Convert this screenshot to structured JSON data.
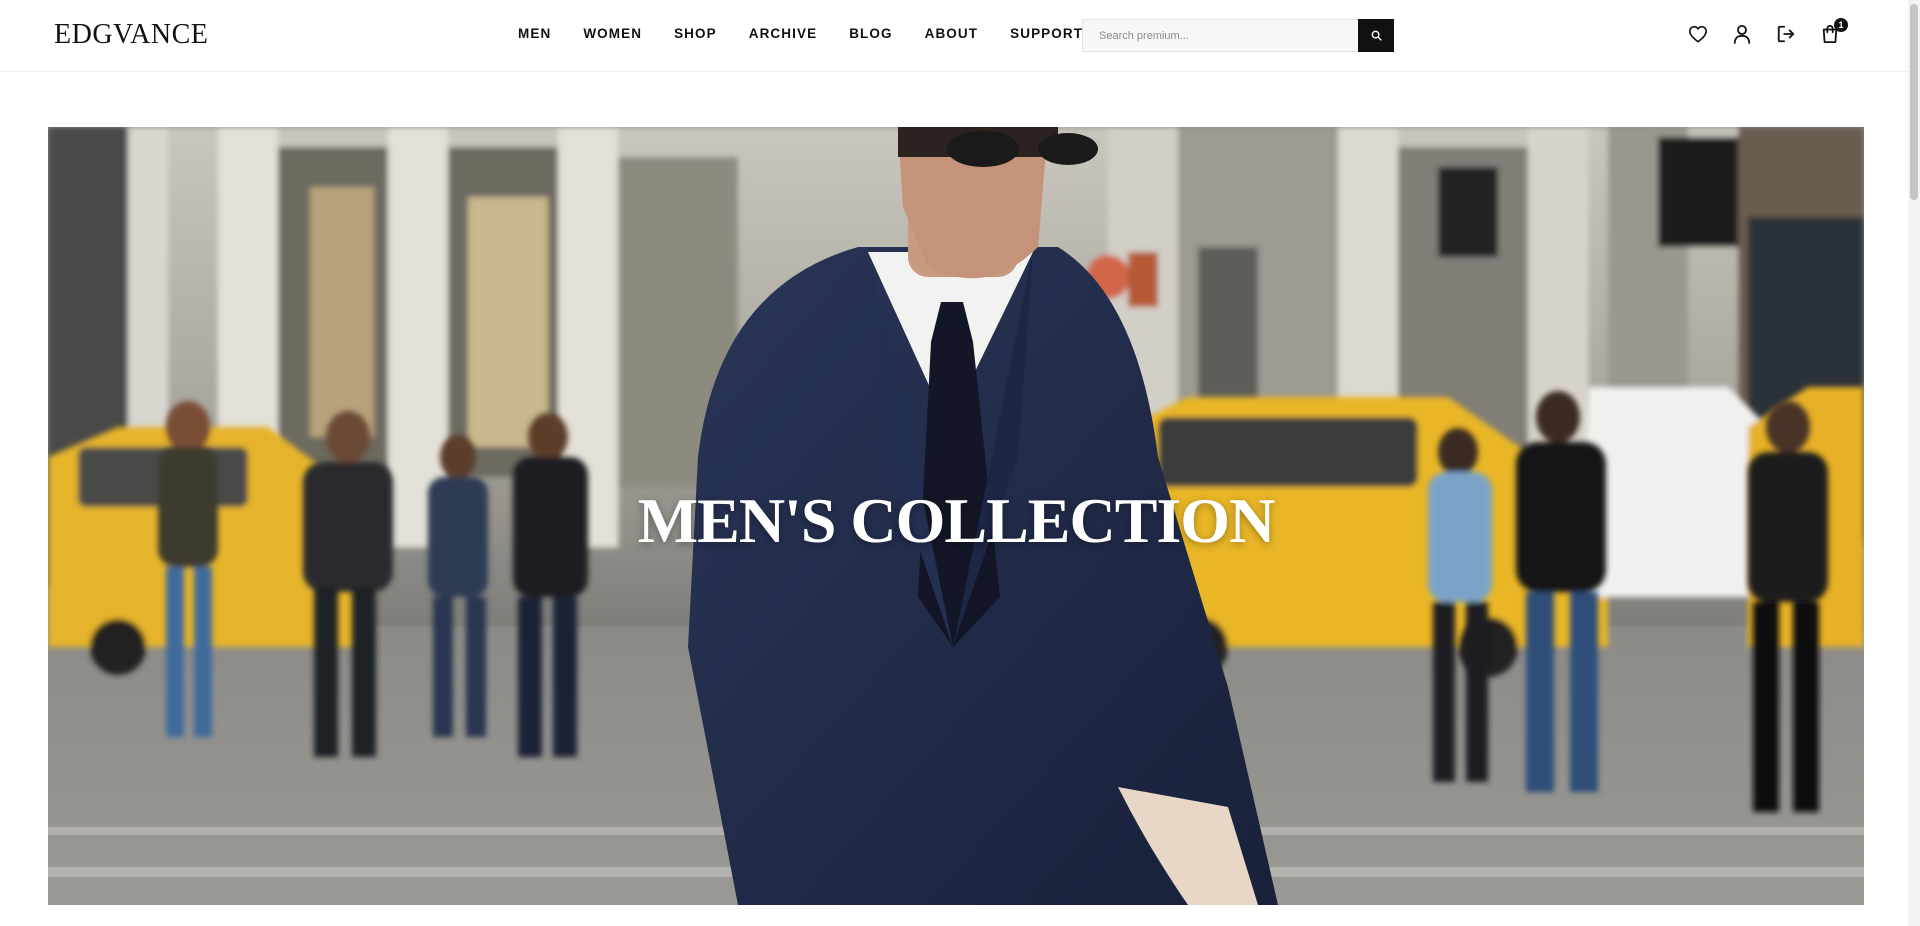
{
  "brand": {
    "name": "EDGVANCE"
  },
  "nav": {
    "items": [
      {
        "label": "MEN"
      },
      {
        "label": "WOMEN"
      },
      {
        "label": "SHOP"
      },
      {
        "label": "ARCHIVE"
      },
      {
        "label": "BLOG"
      },
      {
        "label": "ABOUT"
      },
      {
        "label": "SUPPORT"
      }
    ]
  },
  "search": {
    "placeholder": "Search premium...",
    "value": "",
    "button_icon": "search-icon"
  },
  "header_icons": {
    "wishlist": "heart-icon",
    "account": "user-icon",
    "logout": "logout-icon",
    "cart": "shopping-bag-icon",
    "cart_count": "1"
  },
  "hero": {
    "title": "MEN'S COLLECTION",
    "image": "man in navy suit and sunglasses walking on city street with yellow taxis"
  },
  "colors": {
    "primary": "#111111",
    "surface": "#ffffff",
    "search_bg": "#f7f7f7",
    "suit_navy": "#1f2a4a",
    "taxi_yellow": "#e8b627"
  }
}
